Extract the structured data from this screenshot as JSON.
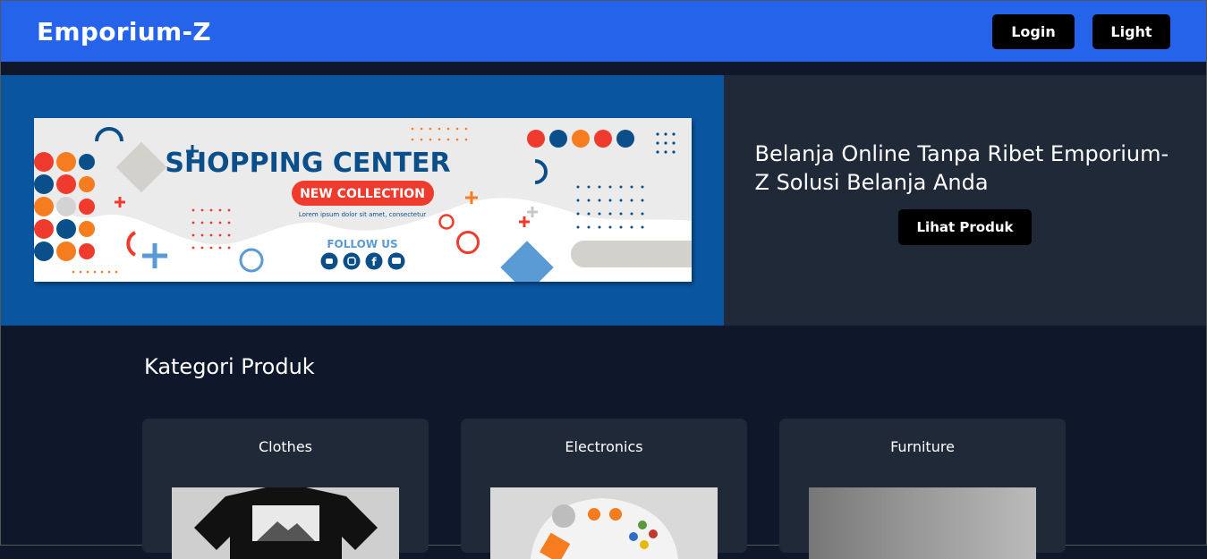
{
  "navbar": {
    "brand": "Emporium-Z",
    "login_label": "Login",
    "theme_label": "Light"
  },
  "hero": {
    "headline": "Belanja Online Tanpa Ribet Emporium-Z Solusi Belanja Anda",
    "cta_label": "Lihat Produk",
    "banner": {
      "title": "SHOPPING CENTER",
      "badge": "NEW COLLECTION",
      "tagline": "Lorem ipsum dolor sit amet, consectetur",
      "follow": "FOLLOW US",
      "social_icons": [
        "twitter-icon",
        "instagram-icon",
        "facebook-icon",
        "youtube-icon"
      ]
    }
  },
  "categories": {
    "title": "Kategori Produk",
    "items": [
      {
        "label": "Clothes"
      },
      {
        "label": "Electronics"
      },
      {
        "label": "Furniture"
      }
    ]
  },
  "colors": {
    "navbar": "#2563eb",
    "page_bg": "#0f172a",
    "panel_bg": "#1f2937",
    "hero_left_bg": "#0a55a0",
    "banner_blue": "#0b4f8a",
    "banner_red": "#ef3b2d",
    "banner_orange": "#f57c1f"
  }
}
